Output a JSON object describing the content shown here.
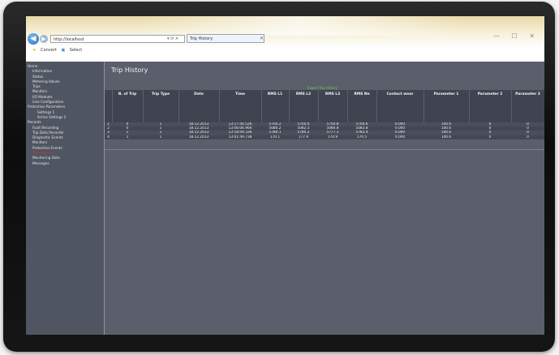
{
  "browser": {
    "address": "http://localhost",
    "address_controls": "▾ ⟳ ✕",
    "tab_title": "Trip History",
    "tab_close": "✕",
    "window_controls": "— ☐ ✕",
    "favorites": [
      "Convert",
      "Select"
    ]
  },
  "sidebar": {
    "items": [
      {
        "label": "Home",
        "level": 0
      },
      {
        "label": "Information",
        "level": 1
      },
      {
        "label": "Status",
        "level": 1
      },
      {
        "label": "Metering Values",
        "level": 1
      },
      {
        "label": "Trips",
        "level": 1
      },
      {
        "label": "Monitors",
        "level": 1
      },
      {
        "label": "I/O Modules",
        "level": 1
      },
      {
        "label": "Line Configuration",
        "level": 1
      },
      {
        "label": "Protection Parameters",
        "level": 0
      },
      {
        "label": "Settings 1",
        "level": 2
      },
      {
        "label": "Active Settings 2",
        "level": 2
      },
      {
        "label": "Records",
        "level": 0
      },
      {
        "label": "Fault Recording",
        "level": 1
      },
      {
        "label": "Trip Data Recorder",
        "level": 1
      },
      {
        "label": "Diagnostic Events",
        "level": 1
      },
      {
        "label": "Monitors",
        "level": 1
      },
      {
        "label": "Protection Events",
        "level": 1
      },
      {
        "label": "Trip History",
        "level": 1,
        "active": true
      },
      {
        "label": "Monitoring Data",
        "level": 1
      },
      {
        "label": "Messages",
        "level": 1
      }
    ]
  },
  "page": {
    "title": "Trip History",
    "export_link": "Export Trip History"
  },
  "table": {
    "columns": [
      "N. of Trip",
      "Trip Type",
      "Date",
      "Time",
      "RMS L1",
      "RMS L2",
      "RMS L3",
      "RMS Ne",
      "Contact wear",
      "Parameter 1",
      "Parameter 2",
      "Parameter 3"
    ],
    "rows": [
      [
        "1",
        "0",
        "1",
        "18.12.2013",
        "13:17:40.526",
        "5700.2",
        "5700.6",
        "5700.8",
        "5700.6",
        "0.000",
        "100.6",
        "0",
        "0"
      ],
      [
        "2",
        "0",
        "1",
        "18.12.2013",
        "13:06:06.966",
        "5080.2",
        "5082.5",
        "5080.8",
        "5083.8",
        "0.000",
        "100.6",
        "0",
        "0"
      ],
      [
        "3",
        "1",
        "1",
        "18.12.2013",
        "13:18:49.336",
        "5780.1",
        "5780.2",
        "5777.1",
        "5783.4",
        "0.000",
        "100.6",
        "0",
        "0"
      ],
      [
        "4",
        "1",
        "1",
        "18.12.2013",
        "13:01:49.738",
        "170.1",
        "177.9",
        "170.9",
        "170.5",
        "0.000",
        "100.6",
        "0",
        "0"
      ]
    ]
  },
  "icons": {
    "back": "back-arrow-icon",
    "forward": "forward-arrow-icon",
    "favorites": "star-icon"
  }
}
